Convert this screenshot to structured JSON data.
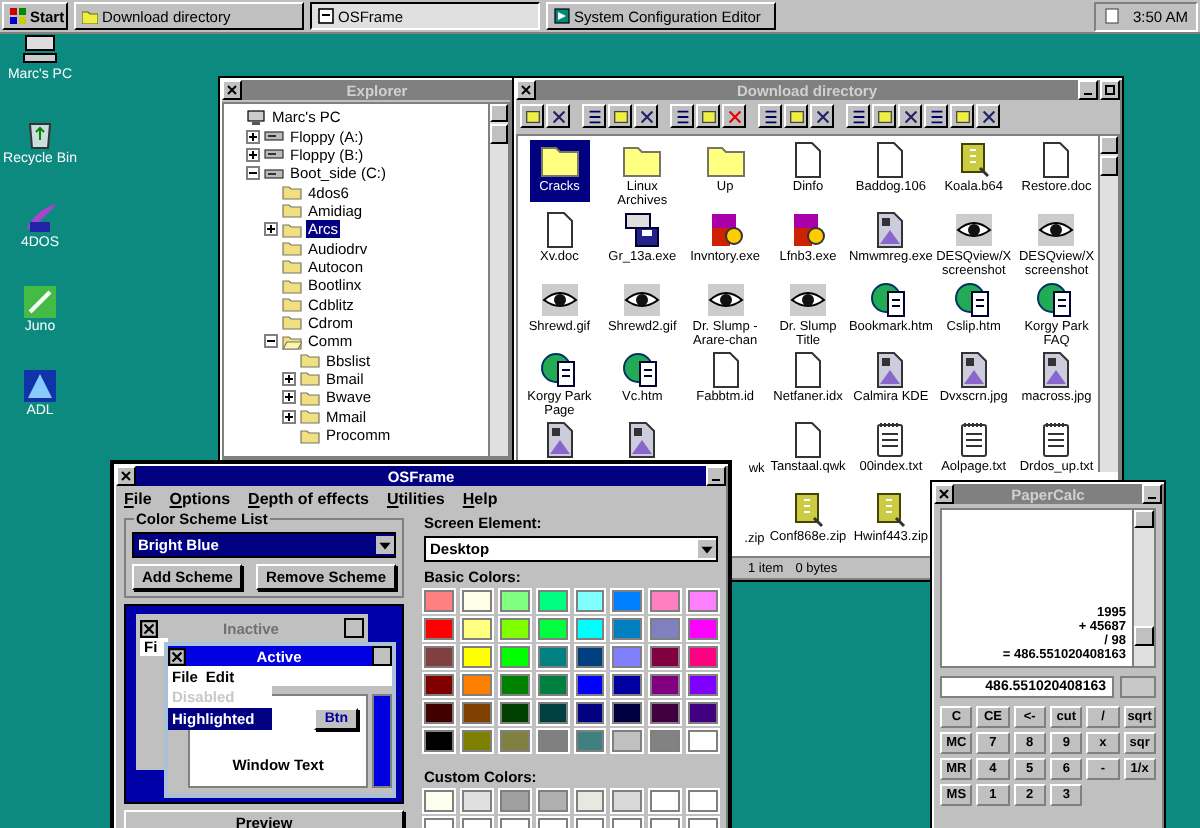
{
  "taskbar": {
    "start": "Start",
    "tasks": [
      {
        "label": "Download directory",
        "kind": "folder",
        "selected": false
      },
      {
        "label": "OSFrame",
        "kind": "app",
        "selected": true
      },
      {
        "label": "System Configuration Editor",
        "kind": "settings",
        "selected": false
      }
    ],
    "clock": "3:50 AM"
  },
  "desktop_icons": [
    {
      "label": "Marc's PC",
      "kind": "computer"
    },
    {
      "label": "Recycle Bin",
      "kind": "recycle"
    },
    {
      "label": "4DOS",
      "kind": "feather"
    },
    {
      "label": "Juno",
      "kind": "pen"
    },
    {
      "label": "ADL",
      "kind": "triangle"
    }
  ],
  "explorer": {
    "title": "Explorer",
    "tree": [
      {
        "label": "Marc's PC",
        "kind": "computer",
        "selected": false,
        "children": [
          {
            "label": "Floppy (A:)",
            "kind": "drive",
            "expandable": true,
            "expanded": false,
            "selected": false
          },
          {
            "label": "Floppy (B:)",
            "kind": "drive",
            "expandable": true,
            "expanded": false,
            "selected": false
          },
          {
            "label": "Boot_side (C:)",
            "kind": "drive",
            "expandable": true,
            "expanded": true,
            "selected": false,
            "children": [
              {
                "label": "4dos6",
                "kind": "folder",
                "expandable": false,
                "expanded": false,
                "selected": false
              },
              {
                "label": "Amidiag",
                "kind": "folder",
                "expandable": false,
                "expanded": false,
                "selected": false
              },
              {
                "label": "Arcs",
                "kind": "folder",
                "expandable": true,
                "expanded": false,
                "selected": true
              },
              {
                "label": "Audiodrv",
                "kind": "folder",
                "expandable": false,
                "expanded": false,
                "selected": false
              },
              {
                "label": "Autocon",
                "kind": "folder",
                "expandable": false,
                "expanded": false,
                "selected": false
              },
              {
                "label": "Bootlinx",
                "kind": "folder",
                "expandable": false,
                "expanded": false,
                "selected": false
              },
              {
                "label": "Cdblitz",
                "kind": "folder",
                "expandable": false,
                "expanded": false,
                "selected": false
              },
              {
                "label": "Cdrom",
                "kind": "folder",
                "expandable": false,
                "expanded": false,
                "selected": false
              },
              {
                "label": "Comm",
                "kind": "folder",
                "expandable": true,
                "expanded": true,
                "selected": false,
                "children": [
                  {
                    "label": "Bbslist",
                    "kind": "folder",
                    "expandable": false,
                    "expanded": false,
                    "selected": false
                  },
                  {
                    "label": "Bmail",
                    "kind": "folder",
                    "expandable": true,
                    "expanded": false,
                    "selected": false
                  },
                  {
                    "label": "Bwave",
                    "kind": "folder",
                    "expandable": true,
                    "expanded": false,
                    "selected": false
                  },
                  {
                    "label": "Mmail",
                    "kind": "folder",
                    "expandable": true,
                    "expanded": false,
                    "selected": false
                  },
                  {
                    "label": "Procomm",
                    "kind": "folder",
                    "expandable": false,
                    "expanded": false,
                    "selected": false
                  }
                ]
              }
            ]
          }
        ]
      }
    ]
  },
  "download": {
    "title": "Download directory",
    "rows": [
      [
        {
          "label": "Cracks",
          "kind": "folder",
          "selected": true
        },
        {
          "label": "Linux Archives",
          "kind": "folder",
          "selected": false
        },
        {
          "label": "Up",
          "kind": "folder",
          "selected": false
        },
        {
          "label": "Dinfo",
          "kind": "doc",
          "selected": false
        },
        {
          "label": "Baddog.106",
          "kind": "doc",
          "selected": false
        },
        {
          "label": "Koala.b64",
          "kind": "zip",
          "selected": false
        },
        {
          "label": "Restore.doc",
          "kind": "doc",
          "selected": false
        }
      ],
      [
        {
          "label": "Xv.doc",
          "kind": "doc",
          "selected": false
        },
        {
          "label": "Gr_13a.exe",
          "kind": "installer",
          "selected": false
        },
        {
          "label": "Invntory.exe",
          "kind": "app",
          "selected": false
        },
        {
          "label": "Lfnb3.exe",
          "kind": "app",
          "selected": false
        },
        {
          "label": "Nmwmreg.exe",
          "kind": "picture",
          "selected": false
        },
        {
          "label": "DESQview/X screenshot",
          "kind": "image",
          "selected": false
        },
        {
          "label": "DESQview/X screenshot",
          "kind": "image",
          "selected": false
        }
      ],
      [
        {
          "label": "Shrewd.gif",
          "kind": "image",
          "selected": false
        },
        {
          "label": "Shrewd2.gif",
          "kind": "image",
          "selected": false
        },
        {
          "label": "Dr. Slump - Arare-chan",
          "kind": "image",
          "selected": false
        },
        {
          "label": "Dr. Slump Title",
          "kind": "image",
          "selected": false
        },
        {
          "label": "Bookmark.htm",
          "kind": "web",
          "selected": false
        },
        {
          "label": "Cslip.htm",
          "kind": "web",
          "selected": false
        },
        {
          "label": "Korgy Park FAQ",
          "kind": "web",
          "selected": false
        }
      ],
      [
        {
          "label": "Korgy Park Page",
          "kind": "web",
          "selected": false
        },
        {
          "label": "Vc.htm",
          "kind": "web",
          "selected": false
        },
        {
          "label": "Fabbtm.id",
          "kind": "doc",
          "selected": false
        },
        {
          "label": "Netfaner.idx",
          "kind": "doc",
          "selected": false
        },
        {
          "label": "Calmira KDE",
          "kind": "picture",
          "selected": false
        },
        {
          "label": "Dvxscrn.jpg",
          "kind": "picture",
          "selected": false
        },
        {
          "label": "macross.jpg",
          "kind": "picture",
          "selected": false
        }
      ],
      [
        {
          "kind": "picture",
          "selected": false
        },
        {
          "kind": "picture",
          "selected": false
        },
        {
          "label": "wk",
          "clipped": true,
          "selected": false
        },
        {
          "label": "Tanstaal.qwk",
          "kind": "doc",
          "selected": false
        },
        {
          "label": "00index.txt",
          "kind": "text",
          "selected": false
        },
        {
          "label": "Aolpage.txt",
          "kind": "text",
          "selected": false
        },
        {
          "label": "Drdos_up.txt",
          "kind": "text",
          "selected": false
        }
      ],
      [
        null,
        null,
        {
          "label": ".zip",
          "clipped": true,
          "selected": false
        },
        {
          "label": "Conf868e.zip",
          "kind": "zip",
          "selected": false
        },
        {
          "label": "Hwinf443.zip",
          "kind": "zip",
          "selected": false
        },
        null,
        null
      ]
    ],
    "status": [
      "1 item",
      "0 bytes"
    ]
  },
  "osframe": {
    "title": "OSFrame",
    "menu": [
      "File",
      "Options",
      "Depth of effects",
      "Utilities",
      "Help"
    ],
    "scheme_group": "Color Scheme List",
    "scheme": "Bright Blue",
    "buttons": [
      "Add Scheme",
      "Remove Scheme"
    ],
    "preview": {
      "inactive_title": "Inactive",
      "inactive_menu": "Fi",
      "active_title": "Active",
      "active_menu": [
        "File",
        "Edit"
      ],
      "menu_items": [
        {
          "label": "Disabled",
          "disabled": true,
          "selected": false
        },
        {
          "label": "Highlighted",
          "disabled": false,
          "selected": true
        }
      ],
      "button": "Btn",
      "window_text": "Window Text"
    },
    "preview_button": "Preview",
    "screen_element_label": "Screen Element:",
    "screen_element": "Desktop",
    "basic_label": "Basic Colors:",
    "basic_colors": [
      {
        "color": "#ff8080"
      },
      {
        "color": "#ffffe8"
      },
      {
        "color": "#80ff80"
      },
      {
        "color": "#00ff80"
      },
      {
        "color": "#80ffff"
      },
      {
        "color": "#0080ff"
      },
      {
        "color": "#ff80c0"
      },
      {
        "color": "#ff80ff"
      },
      {
        "color": "#ff0000"
      },
      {
        "color": "#ffff80"
      },
      {
        "color": "#80ff00"
      },
      {
        "color": "#00ff40"
      },
      {
        "color": "#00ffff"
      },
      {
        "color": "#0080c0"
      },
      {
        "color": "#8080c0"
      },
      {
        "color": "#ff00ff"
      },
      {
        "color": "#804040"
      },
      {
        "color": "#ffff00"
      },
      {
        "color": "#00ff00"
      },
      {
        "color": "#008080"
      },
      {
        "color": "#004080"
      },
      {
        "color": "#8080ff"
      },
      {
        "color": "#800040"
      },
      {
        "color": "#ff0080"
      },
      {
        "color": "#800000"
      },
      {
        "color": "#ff8000"
      },
      {
        "color": "#008000"
      },
      {
        "color": "#008040"
      },
      {
        "color": "#0000ff"
      },
      {
        "color": "#0000a0"
      },
      {
        "color": "#800080"
      },
      {
        "color": "#8000ff"
      },
      {
        "color": "#400000"
      },
      {
        "color": "#804000"
      },
      {
        "color": "#004000"
      },
      {
        "color": "#004040"
      },
      {
        "color": "#000080"
      },
      {
        "color": "#000040"
      },
      {
        "color": "#400040"
      },
      {
        "color": "#400080"
      },
      {
        "color": "#000000"
      },
      {
        "color": "#808000"
      },
      {
        "color": "#808040"
      },
      {
        "color": "#808080"
      },
      {
        "color": "#408080"
      },
      {
        "color": "#c0c0c0"
      },
      {
        "color": "#828282"
      },
      {
        "color": "#ffffff"
      }
    ],
    "custom_label": "Custom Colors:",
    "custom_colors": [
      {
        "color": "#fffff0"
      },
      {
        "color": "#e0e0e0"
      },
      {
        "color": "#a0a0a0"
      },
      {
        "color": "#b0b0b0"
      },
      {
        "color": "#e8e8e0"
      },
      {
        "color": "#d8d8d8"
      },
      {
        "color": "#ffffff"
      },
      {
        "color": "#ffffff"
      },
      {
        "color": "#ffffff"
      },
      {
        "color": "#ffffff"
      },
      {
        "color": "#ffffff"
      },
      {
        "color": "#ffffff"
      },
      {
        "color": "#ffffff"
      },
      {
        "color": "#ffffff"
      },
      {
        "color": "#ffffff"
      },
      {
        "color": "#ffffff"
      }
    ]
  },
  "calc": {
    "title": "PaperCalc",
    "tape": [
      "1995",
      "+ 45687",
      "/ 98",
      "= 486.551020408163"
    ],
    "display": "486.551020408163",
    "keys": [
      [
        "C",
        "CE",
        "<-",
        "cut",
        "/",
        "sqrt"
      ],
      [
        "MC",
        "7",
        "8",
        "9",
        "x",
        "sqr"
      ],
      [
        "MR",
        "4",
        "5",
        "6",
        "-",
        "1/x"
      ],
      [
        "MS",
        "1",
        "2",
        "3"
      ]
    ]
  }
}
